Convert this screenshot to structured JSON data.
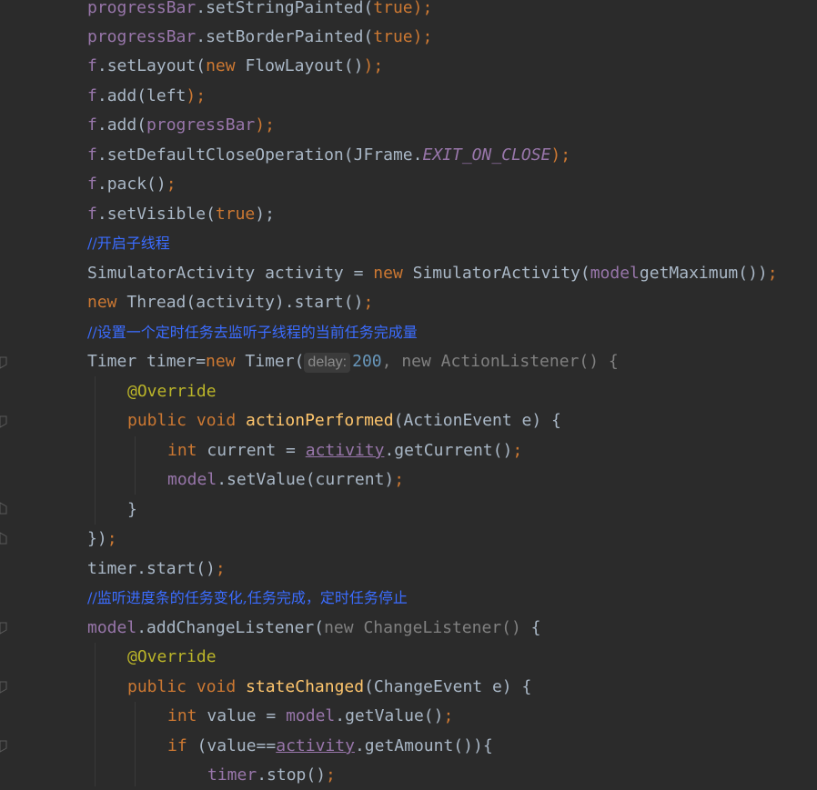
{
  "editor": {
    "lines": {
      "l1": {
        "obj": "progressBar",
        "dot": ".",
        "method": "setStringPainted",
        "open": "(",
        "val": "true",
        "close": ");"
      },
      "l2": {
        "obj": "progressBar",
        "dot": ".",
        "method": "setBorderPainted",
        "open": "(",
        "val": "true",
        "close": ");"
      },
      "l3": {
        "obj": "f",
        "dot": ".",
        "method": "setLayout",
        "open": "(",
        "kw": "new",
        "space": " ",
        "cls": "FlowLayout",
        "rest": "()",
        "close": ");"
      },
      "l4": {
        "obj": "f",
        "dot": ".",
        "method": "add",
        "open": "(",
        "arg": "left",
        "close": ");"
      },
      "l5": {
        "obj": "f",
        "dot": ".",
        "method": "add",
        "open": "(",
        "arg": "progressBar",
        "close": ");"
      },
      "l6": {
        "obj": "f",
        "dot": ".",
        "method": "setDefaultCloseOperation",
        "open": "(",
        "cls": "JFrame.",
        "cst": "EXIT_ON_CLOSE",
        "close": ");"
      },
      "l7": {
        "obj": "f",
        "dot": ".",
        "method": "pack",
        "open": "()",
        "close": ";"
      },
      "l8": {
        "obj": "f",
        "dot": ".",
        "method": "setVisible",
        "open": "(",
        "val": "true",
        "close": ");"
      },
      "c1": "//开启子线程",
      "l9": {
        "a": "SimulatorActivity activity = ",
        "kw": "new",
        "b": " SimulatorActivity(",
        "fld": "model",
        ".": ".",
        "c": "getMaximum())",
        "close": ";"
      },
      "l10": {
        "kw": "new",
        "a": " Thread(activity).start()",
        "close": ";"
      },
      "c2": "//设置一个定时任务去监听子线程的当前任务完成量",
      "l11": {
        "a": "Timer timer=",
        "kw": "new",
        "b": " Timer(",
        "hint": "delay:",
        "num": "200",
        "c": ", new ActionListener() {"
      },
      "l12": {
        "ann": "@Override"
      },
      "l13": {
        "kw": "public void ",
        "fn": "actionPerformed",
        "a": "(ActionEvent e) {"
      },
      "l14": {
        "kw": "int",
        "a": " current = ",
        "fld": "activity",
        "b": ".getCurrent()",
        "close": ";"
      },
      "l15": {
        "fld": "model",
        "a": ".setValue(current)",
        "close": ";"
      },
      "l16": {
        "a": "}"
      },
      "l17": {
        "a": "})",
        "close": ";"
      },
      "l18": {
        "a": "timer.start()",
        "close": ";"
      },
      "c3": "//监听进度条的任务变化,任务完成，定时任务停止",
      "l19": {
        "fld": "model",
        "a": ".addChangeListener(",
        "gray": "new ChangeListener()",
        "b": " {"
      },
      "l20": {
        "ann": "@Override"
      },
      "l21": {
        "kw": "public void ",
        "fn": "stateChanged",
        "a": "(ChangeEvent e) {"
      },
      "l22": {
        "kw": "int",
        "a": " value = ",
        "fld": "model",
        "b": ".getValue()",
        "close": ";"
      },
      "l23": {
        "kw": "if",
        "a": " (value==",
        "fld": "activity",
        "b": ".getAmount()){"
      },
      "l24": {
        "fld": "timer",
        "a": ".stop()",
        "close": ";"
      }
    }
  }
}
